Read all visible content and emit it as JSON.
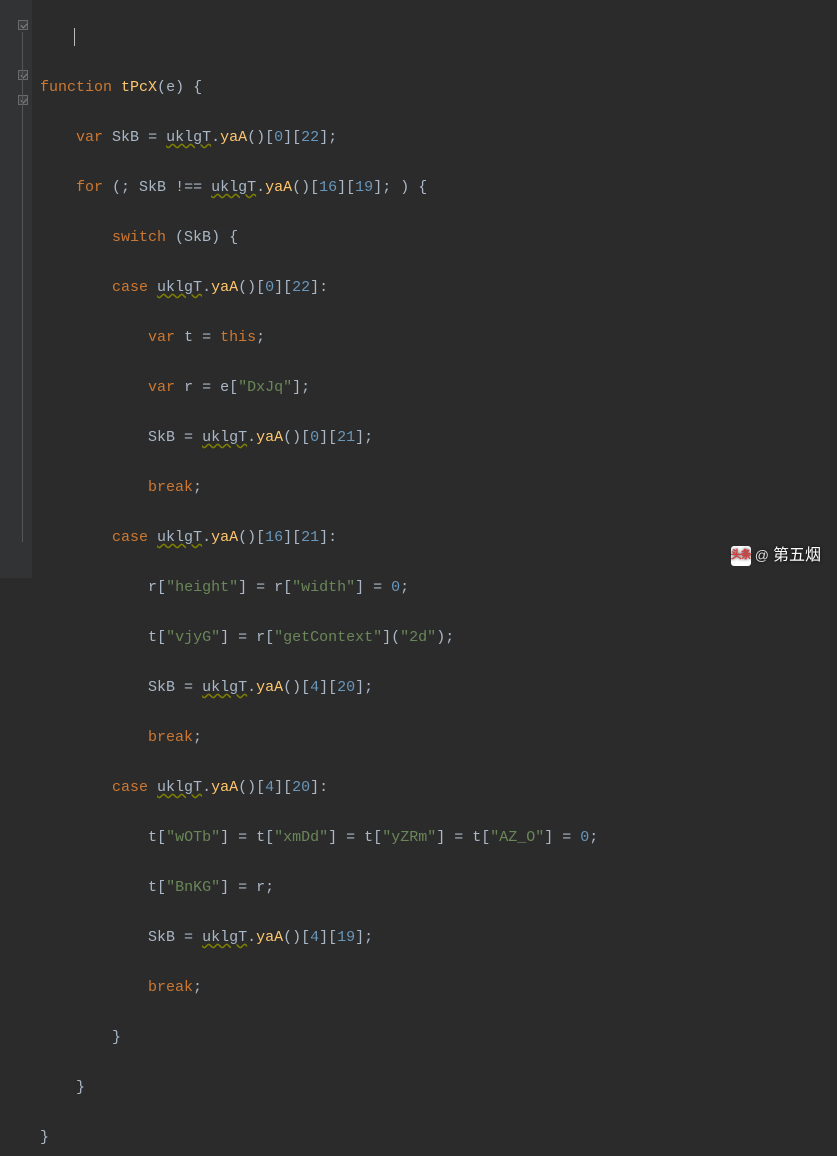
{
  "code": {
    "l1": {
      "kw1": "function",
      "fn": "tPcX",
      "p1": "(",
      "arg": "e",
      "p2": ") {"
    },
    "l2": {
      "kw1": "var",
      "id1": "SkB",
      "op": " = ",
      "id2": "uklgT",
      "p1": ".",
      "m": "yaA",
      "p2": "()[",
      "n1": "0",
      "p3": "][",
      "n2": "22",
      "p4": "];"
    },
    "l3": {
      "kw1": "for",
      "p1": " (; ",
      "id1": "SkB",
      "op": " !== ",
      "id2": "uklgT",
      "p2": ".",
      "m": "yaA",
      "p3": "()[",
      "n1": "16",
      "p4": "][",
      "n2": "19",
      "p5": "]; ) {"
    },
    "l4": {
      "kw1": "switch",
      "p1": " (",
      "id1": "SkB",
      "p2": ") {"
    },
    "l5": {
      "kw1": "case",
      "sp": " ",
      "id1": "uklgT",
      "p1": ".",
      "m": "yaA",
      "p2": "()[",
      "n1": "0",
      "p3": "][",
      "n2": "22",
      "p4": "]:"
    },
    "l6": {
      "kw1": "var",
      "id1": "t",
      "op": " = ",
      "kw2": "this",
      "p1": ";"
    },
    "l7": {
      "kw1": "var",
      "id1": "r",
      "op": " = ",
      "id2": "e",
      "p1": "[",
      "s1": "\"DxJq\"",
      "p2": "];"
    },
    "l8": {
      "id1": "SkB",
      "op": " = ",
      "id2": "uklgT",
      "p1": ".",
      "m": "yaA",
      "p2": "()[",
      "n1": "0",
      "p3": "][",
      "n2": "21",
      "p4": "];"
    },
    "l9": {
      "kw1": "break",
      "p1": ";"
    },
    "l10": {
      "kw1": "case",
      "sp": " ",
      "id1": "uklgT",
      "p1": ".",
      "m": "yaA",
      "p2": "()[",
      "n1": "16",
      "p3": "][",
      "n2": "21",
      "p4": "]:"
    },
    "l11": {
      "id1": "r",
      "p1": "[",
      "s1": "\"height\"",
      "p2": "] = ",
      "id2": "r",
      "p3": "[",
      "s2": "\"width\"",
      "p4": "] = ",
      "n1": "0",
      "p5": ";"
    },
    "l12": {
      "id1": "t",
      "p1": "[",
      "s1": "\"vjyG\"",
      "p2": "] = ",
      "id2": "r",
      "p3": "[",
      "s2": "\"getContext\"",
      "p4": "](",
      "s3": "\"2d\"",
      "p5": ");"
    },
    "l13": {
      "id1": "SkB",
      "op": " = ",
      "id2": "uklgT",
      "p1": ".",
      "m": "yaA",
      "p2": "()[",
      "n1": "4",
      "p3": "][",
      "n2": "20",
      "p4": "];"
    },
    "l14": {
      "kw1": "break",
      "p1": ";"
    },
    "l15": {
      "kw1": "case",
      "sp": " ",
      "id1": "uklgT",
      "p1": ".",
      "m": "yaA",
      "p2": "()[",
      "n1": "4",
      "p3": "][",
      "n2": "20",
      "p4": "]:"
    },
    "l16": {
      "id1": "t",
      "p1": "[",
      "s1": "\"wOTb\"",
      "p2": "] = ",
      "id2": "t",
      "p3": "[",
      "s2": "\"xmDd\"",
      "p4": "] = ",
      "id3": "t",
      "p5": "[",
      "s3": "\"yZRm\"",
      "p6": "] = ",
      "id4": "t",
      "p7": "[",
      "s4": "\"AZ_O\"",
      "p8": "] = ",
      "n1": "0",
      "p9": ";"
    },
    "l17": {
      "id1": "t",
      "p1": "[",
      "s1": "\"BnKG\"",
      "p2": "] = ",
      "id2": "r",
      "p3": ";"
    },
    "l18": {
      "id1": "SkB",
      "op": " = ",
      "id2": "uklgT",
      "p1": ".",
      "m": "yaA",
      "p2": "()[",
      "n1": "4",
      "p3": "][",
      "n2": "19",
      "p4": "];"
    },
    "l19": {
      "kw1": "break",
      "p1": ";"
    },
    "l20": {
      "p1": "}"
    },
    "l21": {
      "p1": "}"
    },
    "l22": {
      "p1": "}"
    }
  },
  "watermark": {
    "logo": "头条",
    "at": "@",
    "author": "第五烟"
  },
  "colors": {
    "bg": "#2b2b2b",
    "keyword": "#cc7832",
    "function": "#ffc66d",
    "number": "#6897bb",
    "string": "#6a8759",
    "text": "#a9b7c6"
  }
}
